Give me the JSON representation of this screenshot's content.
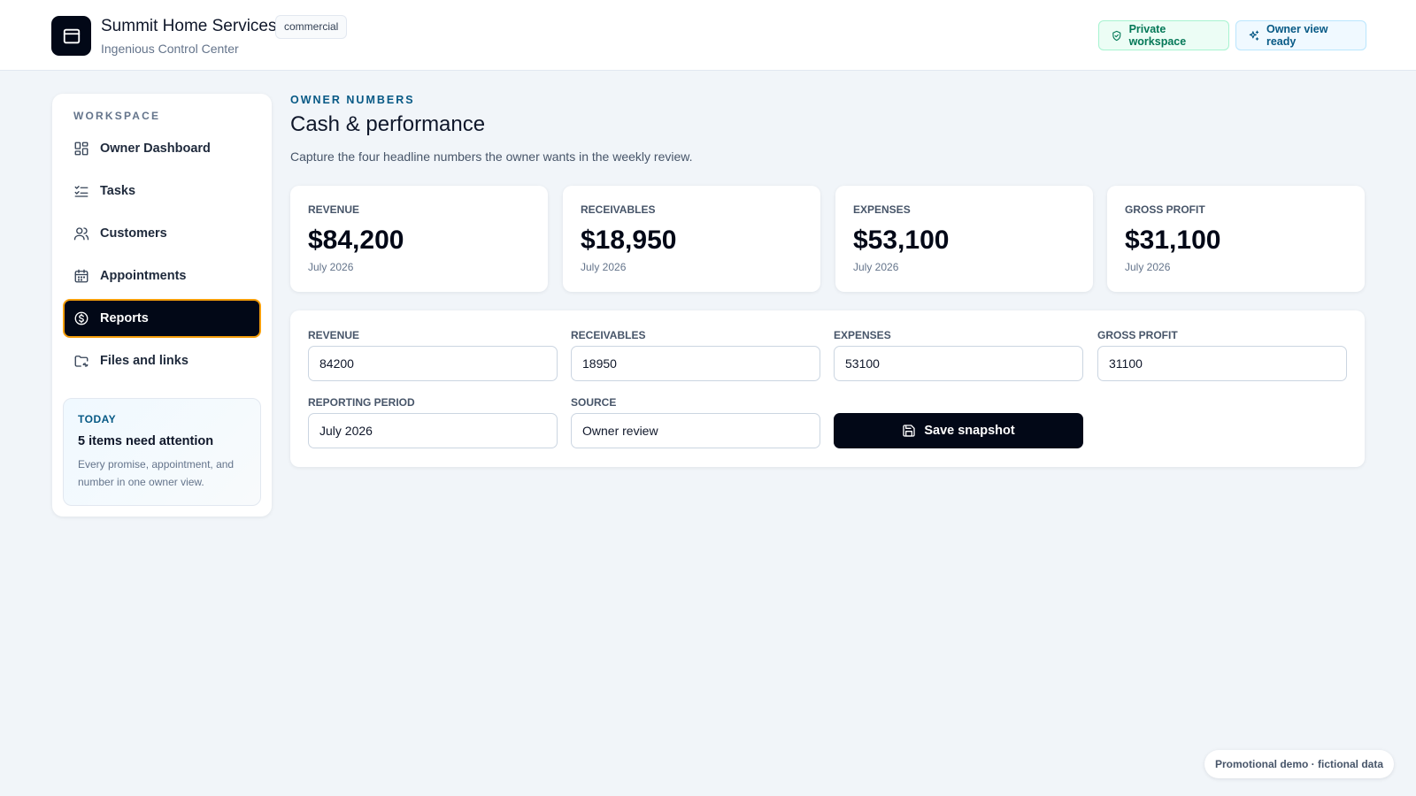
{
  "header": {
    "brand_name": "Summit Home Services",
    "brand_tag": "commercial",
    "brand_subtitle": "Ingenious Control Center",
    "private_workspace": "Private workspace",
    "owner_view": "Owner view ready"
  },
  "sidebar": {
    "section_label": "WORKSPACE",
    "items": [
      {
        "label": "Owner Dashboard",
        "icon": "dashboard-icon"
      },
      {
        "label": "Tasks",
        "icon": "list-checks-icon"
      },
      {
        "label": "Customers",
        "icon": "users-icon"
      },
      {
        "label": "Appointments",
        "icon": "calendar-icon"
      },
      {
        "label": "Reports",
        "icon": "dollar-circle-icon",
        "active": true
      },
      {
        "label": "Files and links",
        "icon": "folder-link-icon"
      }
    ],
    "today": {
      "label": "TODAY",
      "title": "5 items need attention",
      "text": "Every promise, appointment, and number in one owner view."
    }
  },
  "main": {
    "eyebrow": "OWNER NUMBERS",
    "title": "Cash & performance",
    "description": "Capture the four headline numbers the owner wants in the weekly review.",
    "stats": [
      {
        "label": "REVENUE",
        "value": "$84,200",
        "period": "July 2026"
      },
      {
        "label": "RECEIVABLES",
        "value": "$18,950",
        "period": "July 2026"
      },
      {
        "label": "EXPENSES",
        "value": "$53,100",
        "period": "July 2026"
      },
      {
        "label": "GROSS PROFIT",
        "value": "$31,100",
        "period": "July 2026"
      }
    ],
    "form": {
      "revenue_label": "REVENUE",
      "revenue_value": "84200",
      "receivables_label": "RECEIVABLES",
      "receivables_value": "18950",
      "expenses_label": "EXPENSES",
      "expenses_value": "53100",
      "gross_profit_label": "GROSS PROFIT",
      "gross_profit_value": "31100",
      "period_label": "REPORTING PERIOD",
      "period_value": "July 2026",
      "source_label": "SOURCE",
      "source_value": "Owner review",
      "save_label": "Save snapshot"
    }
  },
  "footer": {
    "badge": "Promotional demo · fictional data"
  },
  "colors": {
    "accent_dark": "#020817",
    "active_border": "#f59e0b",
    "eyebrow": "#075985",
    "private_green": "#047857"
  }
}
